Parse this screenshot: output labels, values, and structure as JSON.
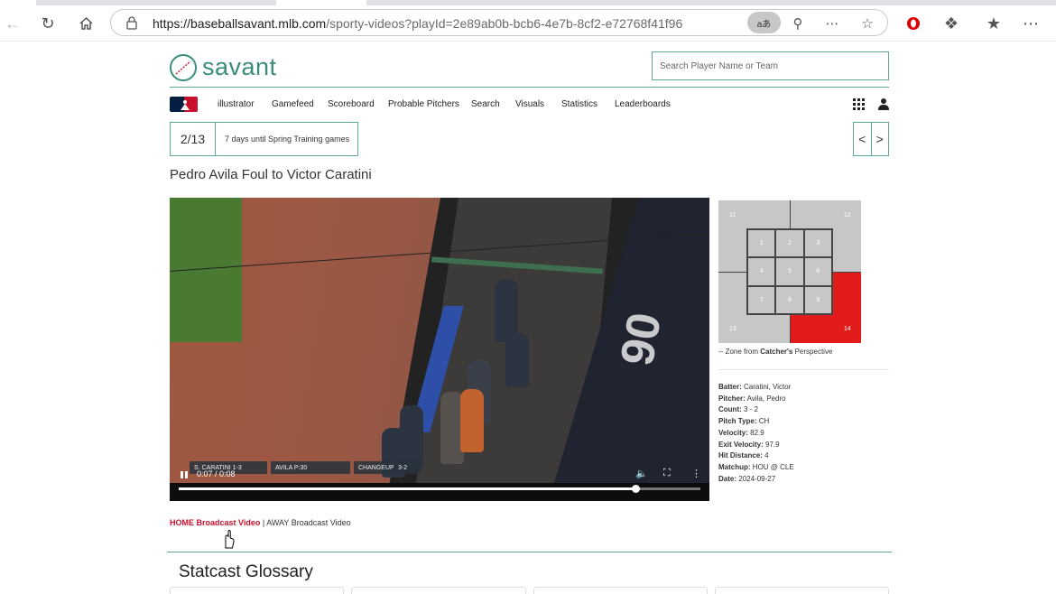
{
  "browser": {
    "url_host": "https://baseballsavant.mlb.com",
    "url_path": "/sporty-videos?playId=2e89ab0b-bcb6-4e7b-8cf2-e72768f41f96",
    "read_aloud_label": "aあ"
  },
  "header": {
    "logo_text": "savant",
    "search_placeholder": "Search Player Name or Team"
  },
  "nav": {
    "items": [
      "illustrator",
      "Gamefeed",
      "Scoreboard",
      "Probable Pitchers",
      "Search",
      "Visuals",
      "Statistics",
      "Leaderboards"
    ]
  },
  "banner": {
    "date": "2/13",
    "message": "7 days until Spring Training games",
    "prev": "<",
    "next": ">"
  },
  "play": {
    "title": "Pedro Avila Foul to Victor Caratini"
  },
  "video": {
    "time": "0:07 / 0:08",
    "progress_fraction": 0.875,
    "scorebug": [
      "S. CARATINI 1-3",
      "AVILA P:30",
      "CHANGEUP",
      "3-2"
    ],
    "wall_text": "90"
  },
  "zone": {
    "cells": [
      "1",
      "2",
      "3",
      "4",
      "5",
      "6",
      "7",
      "8",
      "9"
    ],
    "outer": [
      "11",
      "12",
      "13",
      "14"
    ],
    "highlight_zone": "14",
    "caption_prefix": "-- Zone from ",
    "caption_bold": "Catcher's",
    "caption_suffix": " Perspective"
  },
  "details": [
    {
      "label": "Batter:",
      "value": "Caratini, Victor"
    },
    {
      "label": "Pitcher:",
      "value": "Avila, Pedro"
    },
    {
      "label": "Count:",
      "value": "3 - 2"
    },
    {
      "label": "Pitch Type:",
      "value": "CH"
    },
    {
      "label": "Velocity:",
      "value": "82.9"
    },
    {
      "label": "Exit Velocity:",
      "value": "97.9"
    },
    {
      "label": "Hit Distance:",
      "value": "4"
    },
    {
      "label": "Matchup:",
      "value": "HOU @ CLE"
    },
    {
      "label": "Date:",
      "value": "2024-09-27"
    }
  ],
  "broadcast": {
    "home": "HOME Broadcast Video",
    "separator": " | ",
    "away": "AWAY Broadcast Video"
  },
  "glossary": {
    "title": "Statcast Glossary"
  },
  "colors": {
    "teal": "#3a8d7d",
    "home_red": "#c8102e",
    "zone_red": "#e21b1b"
  }
}
